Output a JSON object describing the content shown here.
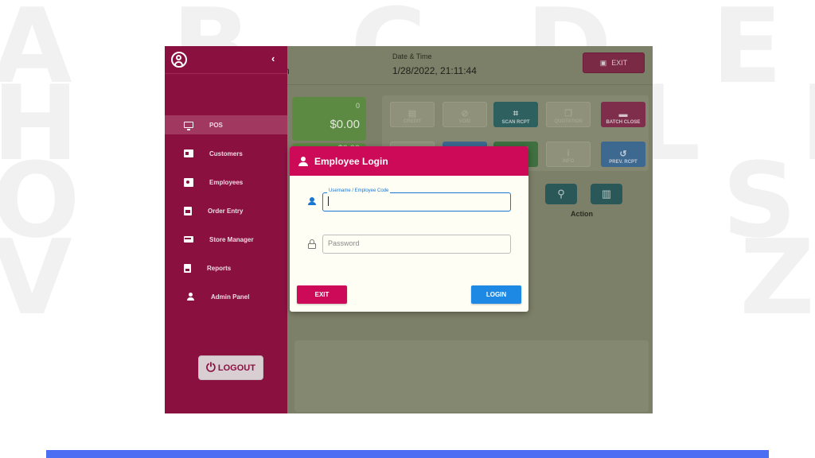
{
  "background": {
    "letter_rows": [
      "A B C D E F G",
      "H I J K L M N",
      "O P Q R S T U",
      "V W X Y Z"
    ]
  },
  "header": {
    "date_time_label": "Date & Time",
    "date_time_value": "1/28/2022, 21:11:44",
    "partial_text": "n",
    "exit_label": "EXIT",
    "exit_icon": "exit-door-icon"
  },
  "totals": {
    "count": "0",
    "amount": "$0.00",
    "secondary": "$0.00"
  },
  "action_tiles": [
    {
      "label": "CREDIT",
      "icon": "card-icon"
    },
    {
      "label": "VOID",
      "icon": "block-icon"
    },
    {
      "label": "SCAN RCPT",
      "icon": "scan-icon"
    },
    {
      "label": "QUOTATION",
      "icon": "quote-icon"
    },
    {
      "label": "BATCH CLOSE",
      "icon": "batch-icon"
    },
    {
      "label": "INFO",
      "icon": "info-icon"
    },
    {
      "label": "PREV. RCPT",
      "icon": "history-icon"
    }
  ],
  "action_label": "Action",
  "sidebar": {
    "items": [
      {
        "label": "POS",
        "icon": "monitor-icon",
        "active": true
      },
      {
        "label": "Customers",
        "icon": "id-card-icon",
        "active": false
      },
      {
        "label": "Employees",
        "icon": "badge-icon",
        "active": false
      },
      {
        "label": "Order Entry",
        "icon": "clipboard-icon",
        "active": false
      },
      {
        "label": "Store Manager",
        "icon": "store-icon",
        "active": false
      },
      {
        "label": "Reports",
        "icon": "report-icon",
        "active": false
      },
      {
        "label": "Admin Panel",
        "icon": "admin-icon",
        "active": false
      }
    ],
    "logout_label": "LOGOUT"
  },
  "modal": {
    "title": "Employee Login",
    "username_label": "Username / Employee Code",
    "username_value": "",
    "password_placeholder": "Password",
    "exit_label": "EXIT",
    "login_label": "LOGIN"
  },
  "colors": {
    "brand": "#cc0a57",
    "sidebar": "#8a1040",
    "login_button": "#1e88e5",
    "bottom_bar": "#4c6ef2"
  }
}
